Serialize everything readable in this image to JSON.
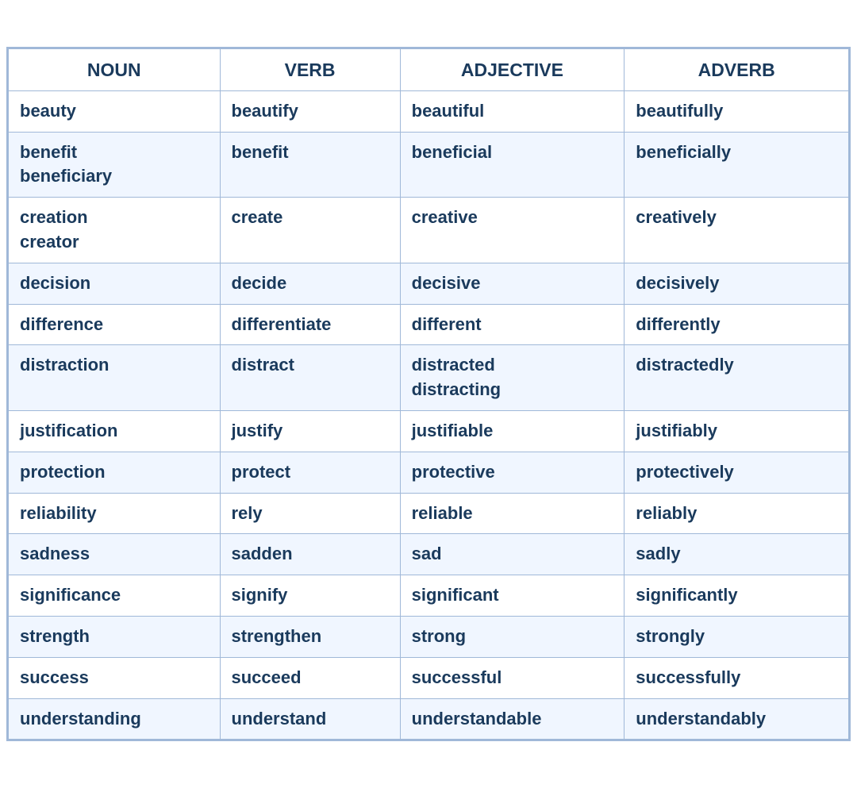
{
  "table": {
    "headers": [
      "NOUN",
      "VERB",
      "ADJECTIVE",
      "ADVERB"
    ],
    "rows": [
      {
        "noun": "beauty",
        "verb": "beautify",
        "adjective": "beautiful",
        "adverb": "beautifully"
      },
      {
        "noun": "benefit\nbeneficiary",
        "verb": "benefit",
        "adjective": "beneficial",
        "adverb": "beneficially"
      },
      {
        "noun": "creation\ncreator",
        "verb": "create",
        "adjective": "creative",
        "adverb": "creatively"
      },
      {
        "noun": "decision",
        "verb": "decide",
        "adjective": "decisive",
        "adverb": "decisively"
      },
      {
        "noun": "difference",
        "verb": "differentiate",
        "adjective": "different",
        "adverb": "differently"
      },
      {
        "noun": "distraction",
        "verb": "distract",
        "adjective": "distracted\ndistracting",
        "adverb": "distractedly"
      },
      {
        "noun": "justification",
        "verb": "justify",
        "adjective": "justifiable",
        "adverb": "justifiably"
      },
      {
        "noun": "protection",
        "verb": "protect",
        "adjective": "protective",
        "adverb": "protectively"
      },
      {
        "noun": "reliability",
        "verb": "rely",
        "adjective": "reliable",
        "adverb": "reliably"
      },
      {
        "noun": "sadness",
        "verb": "sadden",
        "adjective": "sad",
        "adverb": "sadly"
      },
      {
        "noun": "significance",
        "verb": "signify",
        "adjective": "significant",
        "adverb": "significantly"
      },
      {
        "noun": "strength",
        "verb": "strengthen",
        "adjective": "strong",
        "adverb": "strongly"
      },
      {
        "noun": "success",
        "verb": "succeed",
        "adjective": "successful",
        "adverb": "successfully"
      },
      {
        "noun": "understanding",
        "verb": "understand",
        "adjective": "understandable",
        "adverb": "understandably"
      }
    ]
  }
}
